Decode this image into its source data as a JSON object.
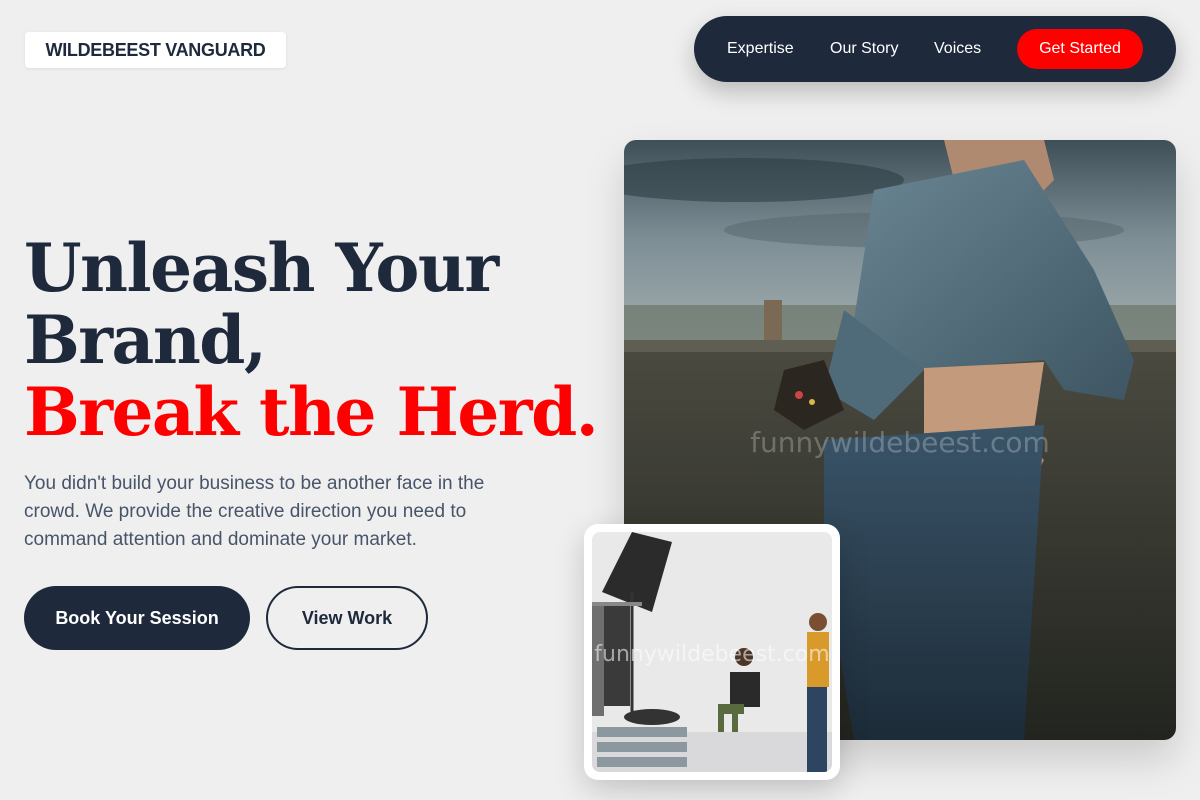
{
  "brand": {
    "logo_text": "WILDEBEEST VANGUARD"
  },
  "nav": {
    "links": [
      "Expertise",
      "Our Story",
      "Voices"
    ],
    "cta_label": "Get Started"
  },
  "hero": {
    "headline_line1": "Unleash Your",
    "headline_line2": "Brand,",
    "headline_accent": "Break the Herd.",
    "subtext": "You didn't build your business to be another face in the crowd. We provide the creative direction you need to command attention and dominate your market.",
    "primary_button": "Book Your Session",
    "secondary_button": "View Work"
  },
  "images": {
    "main_watermark": "funnywildebeest.com",
    "inset_watermark": "funnywildebeest.com"
  },
  "colors": {
    "navy": "#1e293b",
    "accent_red": "#ff0000",
    "background": "#efefef",
    "body_text": "#475569"
  }
}
